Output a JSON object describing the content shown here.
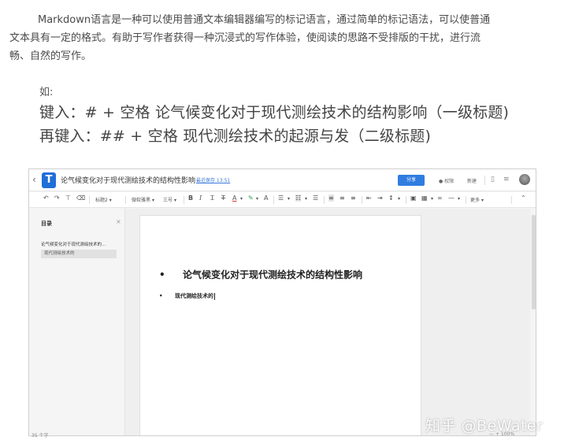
{
  "article": {
    "para_line1": "Markdown语言是一种可以使用普通文本编辑器编写的标记语言，通过简单的标记语法，可以使普通",
    "para_line2": "文本具有一定的格式。有助于写作者获得一种沉浸式的写作体验，使阅读的思路不受排版的干扰，进行流",
    "para_line3": "畅、自然的写作。",
    "example_label": "如:",
    "example_line1": "键入：# + 空格 论气候变化对于现代测绘技术的结构影响（一级标题)",
    "example_line2": "再键入：## + 空格 现代测绘技术的起源与发（二级标题)"
  },
  "editor": {
    "titlebar": {
      "doc_title": "论气候变化对于现代测绘技术的结构性影响",
      "save_status": "最近保存 13:51",
      "share_label": "分享",
      "permission_label": "权限",
      "new_label": "新建"
    },
    "toolbar": {
      "heading_style": "标题2",
      "font_family": "微软雅黑",
      "font_size": "三号",
      "more_label": "更多"
    },
    "sidebar": {
      "toc_title": "目录",
      "close_glyph": "×",
      "toc_item": "论气候变化对于现代测绘技术的...",
      "toc_subitem": "现代测绘技术的"
    },
    "content": {
      "bullet": "•",
      "heading1": "论气候变化对于现代测绘技术的结构性影响",
      "heading2": "现代测绘技术的"
    },
    "status": {
      "word_count": "35 个字",
      "zoom": "100%"
    }
  },
  "watermark": "知乎 @BeWater"
}
